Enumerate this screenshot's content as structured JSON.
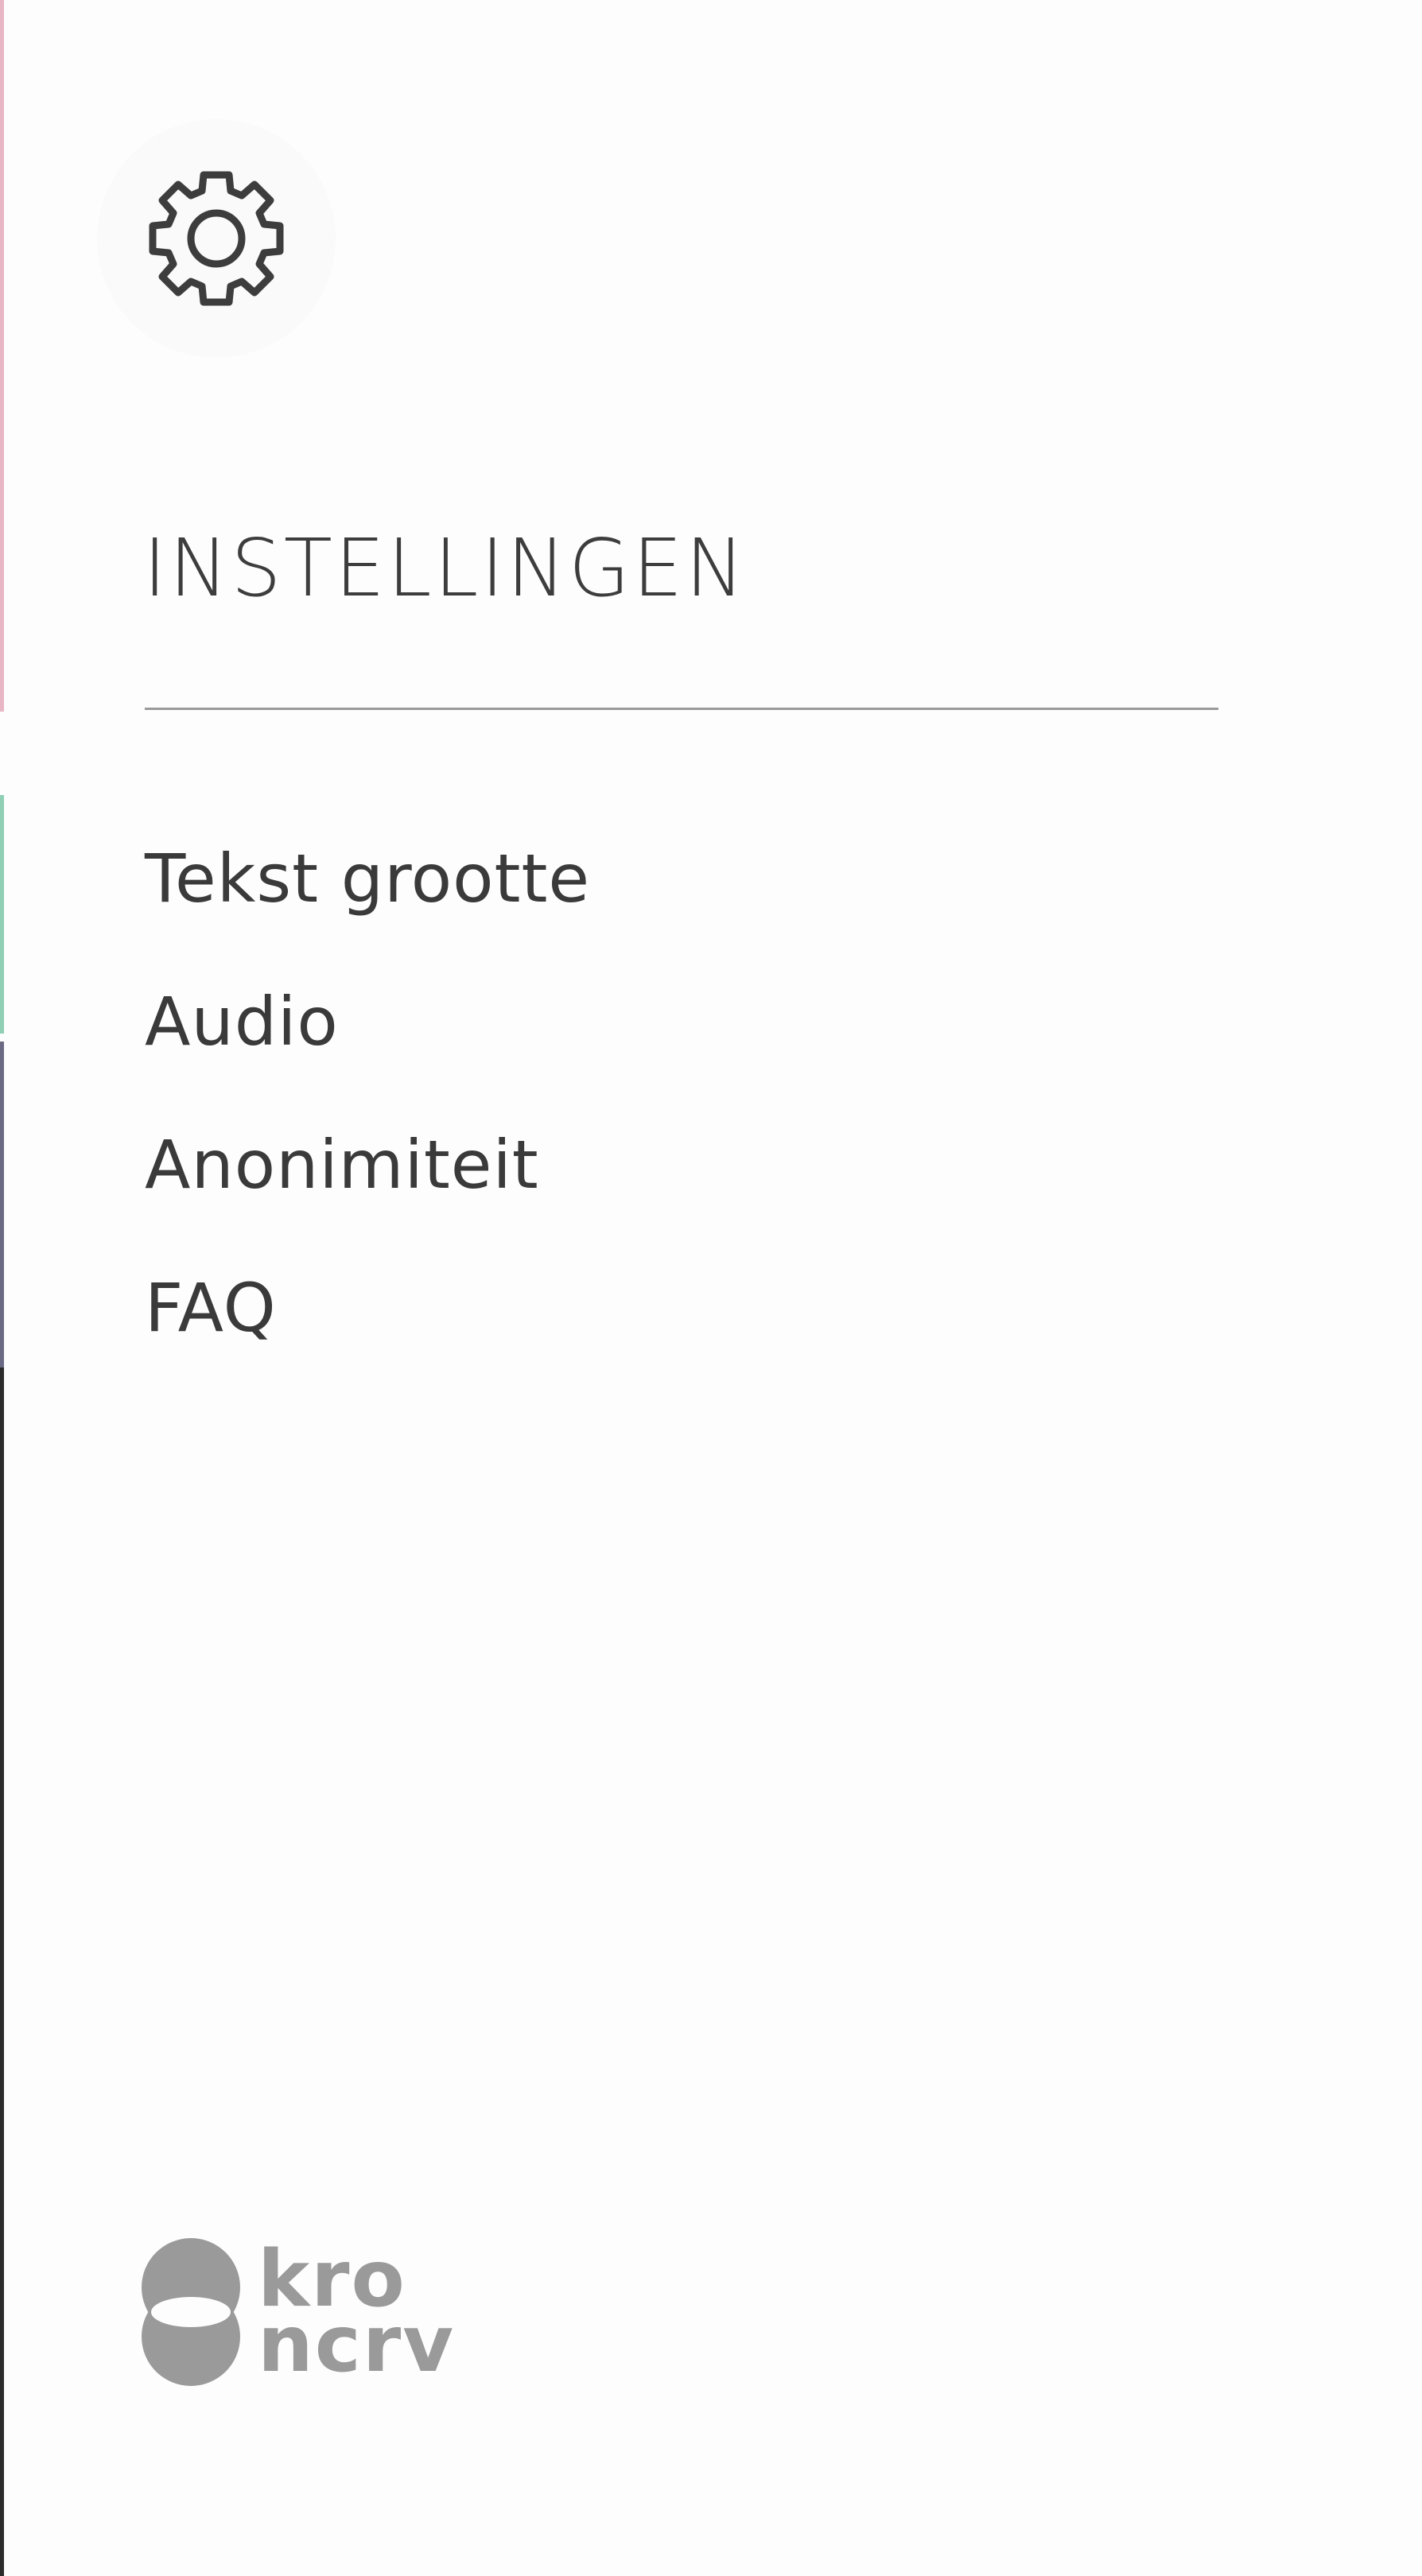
{
  "settings": {
    "title": "INSTELLINGEN",
    "icon": "gear-icon",
    "items": [
      {
        "label": "Tekst grootte"
      },
      {
        "label": "Audio"
      },
      {
        "label": "Anonimiteit"
      },
      {
        "label": "FAQ"
      }
    ]
  },
  "brand": {
    "line1": "kro",
    "line2": "ncrv",
    "color": "#9a9a9a"
  },
  "colors": {
    "text": "#3d3d3d",
    "background": "#fdfdfd",
    "divider": "#9a9a9a"
  }
}
